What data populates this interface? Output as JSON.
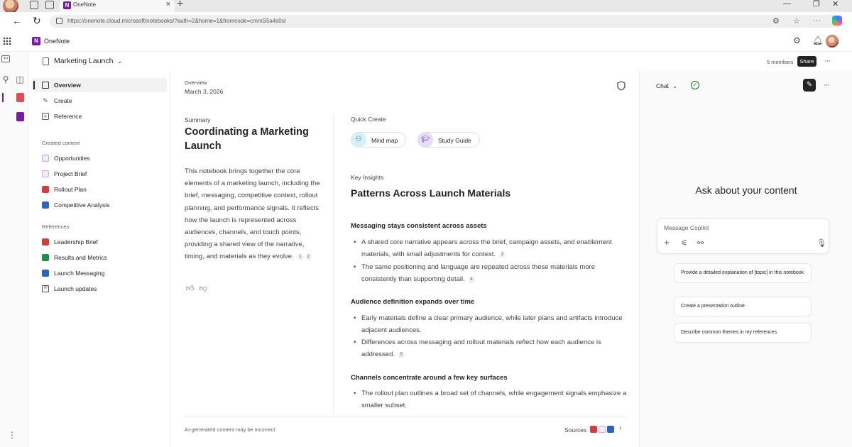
{
  "browser": {
    "tab_title": "OneNote",
    "url": "https://onenote.cloud.microsoft/notebooks/?auth=2&home=1&fromcode=cmmS5a4s0sl"
  },
  "app": {
    "name": "OneNote",
    "notebook_title": "Marketing Launch",
    "members": "5 members",
    "share_label": "Share"
  },
  "sidebar": {
    "top_items": [
      {
        "label": "Overview"
      },
      {
        "label": "Create"
      },
      {
        "label": "Reference"
      }
    ],
    "created_content_label": "Created content",
    "created_items": [
      {
        "label": "Opportunities"
      },
      {
        "label": "Project Brief"
      },
      {
        "label": "Rollout Plan"
      },
      {
        "label": "Competitive Analysis"
      }
    ],
    "references_label": "References",
    "reference_items": [
      {
        "label": "Leadership Brief"
      },
      {
        "label": "Results and Metrics"
      },
      {
        "label": "Launch Messaging"
      },
      {
        "label": "Launch updates"
      }
    ]
  },
  "main": {
    "overview_label": "Overview",
    "date": "March 3, 2026",
    "summary_label": "Summary",
    "summary_title": "Coordinating a Marketing Launch",
    "summary_body": "This notebook brings together the core elements of a marketing launch, including the brief, messaging, competitive context, rollout planning, and performance signals. It reflects how the launch is represented across audiences, channels, and touch points, providing a shared view of the narrative, timing, and materials as they evolve.",
    "summary_citations": [
      "1",
      "2"
    ],
    "quick_create_label": "Quick Create",
    "quick_create": [
      {
        "label": "Mind map"
      },
      {
        "label": "Study Guide"
      }
    ],
    "key_insights_label": "Key Insights",
    "key_insights_title": "Patterns Across Launch Materials",
    "insights": [
      {
        "heading": "Messaging stays consistent across assets",
        "bullets": [
          {
            "text": "A shared core narrative appears across the brief, campaign assets, and enablement materials, with small adjustments for context.",
            "cite": "3"
          },
          {
            "text": "The same positioning and language are repeated across these materials more consistently than supporting detail.",
            "cite": "4"
          }
        ]
      },
      {
        "heading": "Audience definition expands over time",
        "bullets": [
          {
            "text": "Early materials define a clear primary audience, while later plans and artifacts introduce adjacent audiences.",
            "cite": ""
          },
          {
            "text": "Differences across messaging and rollout materials reflect how each audience is addressed.",
            "cite": "5"
          }
        ]
      },
      {
        "heading": "Channels concentrate around a few key surfaces",
        "bullets": [
          {
            "text": "The rollout plan outlines a broad set of channels, while engagement signals emphasize a smaller subset.",
            "cite": ""
          }
        ]
      }
    ],
    "ai_disclaimer": "AI-generated content may be incorrect",
    "sources_label": "Sources"
  },
  "chat": {
    "title": "Chat",
    "ask_title": "Ask about your content",
    "input_placeholder": "Message Copilot",
    "suggestions": [
      {
        "label": "Provide a detailed explanation of [topic] in this notebook"
      },
      {
        "label": "Create a presentation outline"
      },
      {
        "label": "Describe common themes in my references"
      }
    ]
  },
  "colors": {
    "onenote_purple": "#7719aa",
    "mindmap_chip": "#d6f0f5",
    "studyguide_chip": "#e6dcf7",
    "check_green": "#107c10"
  }
}
